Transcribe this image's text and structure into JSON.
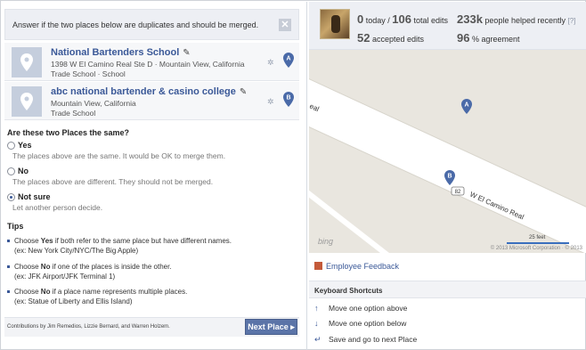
{
  "question_bar": {
    "text": "Answer if the two places below are duplicates and should be merged.",
    "close": "✕"
  },
  "places": [
    {
      "name": "National Bartenders School",
      "address": "1398 W El Camino Real Ste D · Mountain View, California",
      "category": "Trade School · School",
      "marker": "A"
    },
    {
      "name": "abc national bartender & casino college",
      "address": "Mountain View, California",
      "category": "Trade School",
      "marker": "B"
    }
  ],
  "question": "Are these two Places the same?",
  "options": [
    {
      "label": "Yes",
      "desc": "The places above are the same. It would be OK to merge them.",
      "selected": false
    },
    {
      "label": "No",
      "desc": "The places above are different. They should not be merged.",
      "selected": false
    },
    {
      "label": "Not sure",
      "desc": "Let another person decide.",
      "selected": true
    }
  ],
  "tips": {
    "title": "Tips",
    "items": [
      {
        "pre": "Choose ",
        "bold": "Yes",
        "post": " if both refer to the same place but have different names.",
        "example": "(ex: New York City/NYC/The Big Apple)"
      },
      {
        "pre": "Choose ",
        "bold": "No",
        "post": " if one of the places is inside the other.",
        "example": "(ex: JFK Airport/JFK Terminal 1)"
      },
      {
        "pre": "Choose ",
        "bold": "No",
        "post": " if a place name represents multiple places.",
        "example": "(ex: Statue of Liberty and Ellis Island)"
      }
    ]
  },
  "footer": {
    "credits": "Contributions by Jim Remedios, Lizzie Bernard, and Warren Holzem.",
    "next_button": "Next Place ▸"
  },
  "stats": {
    "today": "0",
    "today_label": " today / ",
    "total": "106",
    "total_label": " total edits",
    "helped": "233k",
    "helped_label": " people helped recently ",
    "help": "[?]",
    "accepted": "52",
    "accepted_label": " accepted edits",
    "agreement": "96",
    "agreement_label": " % agreement"
  },
  "map": {
    "road_label": "W El Camino Real",
    "road_label_fragment": "eal",
    "road_number": "82",
    "marker_a": "A",
    "marker_b": "B",
    "scale": "25 feet",
    "provider": "bing",
    "copyright": "© 2013 Microsoft Corporation · © 2013"
  },
  "feedback": "Employee Feedback",
  "shortcuts": {
    "title": "Keyboard Shortcuts",
    "items": [
      {
        "key": "↑",
        "text": "Move one option above"
      },
      {
        "key": "↓",
        "text": "Move one option below"
      },
      {
        "key": "↵",
        "text": "Save and go to next Place"
      }
    ]
  },
  "colors": {
    "accent": "#3b5998",
    "marker": "#4a6aa8",
    "panel": "#edeff4"
  }
}
